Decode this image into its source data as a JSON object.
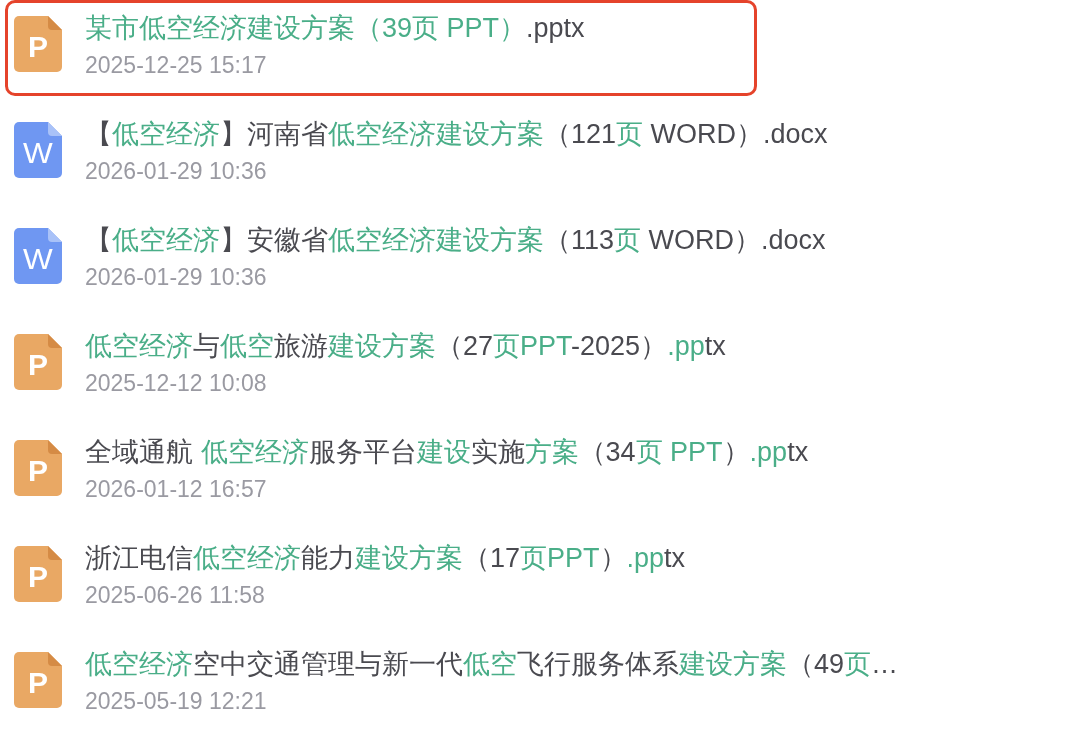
{
  "files": [
    {
      "kind": "ppt",
      "icon_text": "P",
      "selected": true,
      "title": [
        {
          "text": "某市低空经济建设方案（39页 PPT）",
          "match": true
        },
        {
          "text": ".pptx",
          "match": false
        }
      ],
      "date": "2025-12-25 15:17"
    },
    {
      "kind": "word",
      "icon_text": "W",
      "selected": false,
      "title": [
        {
          "text": "【",
          "match": false
        },
        {
          "text": "低空经济",
          "match": true
        },
        {
          "text": "】河南省",
          "match": false
        },
        {
          "text": "低空经济建设方案",
          "match": true
        },
        {
          "text": "（121",
          "match": false
        },
        {
          "text": "页",
          "match": true
        },
        {
          "text": " WORD）.docx",
          "match": false
        }
      ],
      "date": "2026-01-29 10:36"
    },
    {
      "kind": "word",
      "icon_text": "W",
      "selected": false,
      "title": [
        {
          "text": "【",
          "match": false
        },
        {
          "text": "低空经济",
          "match": true
        },
        {
          "text": "】安徽省",
          "match": false
        },
        {
          "text": "低空经济建设方案",
          "match": true
        },
        {
          "text": "（113",
          "match": false
        },
        {
          "text": "页",
          "match": true
        },
        {
          "text": " WORD）.docx",
          "match": false
        }
      ],
      "date": "2026-01-29 10:36"
    },
    {
      "kind": "ppt",
      "icon_text": "P",
      "selected": false,
      "title": [
        {
          "text": "低空经济",
          "match": true
        },
        {
          "text": "与",
          "match": false
        },
        {
          "text": "低空",
          "match": true
        },
        {
          "text": "旅游",
          "match": false
        },
        {
          "text": "建设方案",
          "match": true
        },
        {
          "text": "（27",
          "match": false
        },
        {
          "text": "页PPT",
          "match": true
        },
        {
          "text": "-2025）",
          "match": false
        },
        {
          "text": ".pp",
          "match": true
        },
        {
          "text": "tx",
          "match": false
        }
      ],
      "date": "2025-12-12 10:08"
    },
    {
      "kind": "ppt",
      "icon_text": "P",
      "selected": false,
      "title": [
        {
          "text": "全域通航 ",
          "match": false
        },
        {
          "text": "低空经济",
          "match": true
        },
        {
          "text": "服务平台",
          "match": false
        },
        {
          "text": "建设",
          "match": true
        },
        {
          "text": "实施",
          "match": false
        },
        {
          "text": "方案",
          "match": true
        },
        {
          "text": "（34",
          "match": false
        },
        {
          "text": "页 PPT",
          "match": true
        },
        {
          "text": "）",
          "match": false
        },
        {
          "text": ".pp",
          "match": true
        },
        {
          "text": "tx",
          "match": false
        }
      ],
      "date": "2026-01-12 16:57"
    },
    {
      "kind": "ppt",
      "icon_text": "P",
      "selected": false,
      "title": [
        {
          "text": "浙江电信",
          "match": false
        },
        {
          "text": "低空经济",
          "match": true
        },
        {
          "text": "能力",
          "match": false
        },
        {
          "text": "建设方案",
          "match": true
        },
        {
          "text": "（17",
          "match": false
        },
        {
          "text": "页PPT",
          "match": true
        },
        {
          "text": "）",
          "match": false
        },
        {
          "text": ".pp",
          "match": true
        },
        {
          "text": "tx",
          "match": false
        }
      ],
      "date": "2025-06-26 11:58"
    },
    {
      "kind": "ppt",
      "icon_text": "P",
      "selected": false,
      "title": [
        {
          "text": "低空经济",
          "match": true
        },
        {
          "text": "空中交通管理与新一代",
          "match": false
        },
        {
          "text": "低空",
          "match": true
        },
        {
          "text": "飞行服务体系",
          "match": false
        },
        {
          "text": "建设方案",
          "match": true
        },
        {
          "text": "（49",
          "match": false
        },
        {
          "text": "页",
          "match": true
        },
        {
          "text": "…",
          "match": false
        }
      ],
      "date": "2025-05-19 12:21"
    }
  ]
}
